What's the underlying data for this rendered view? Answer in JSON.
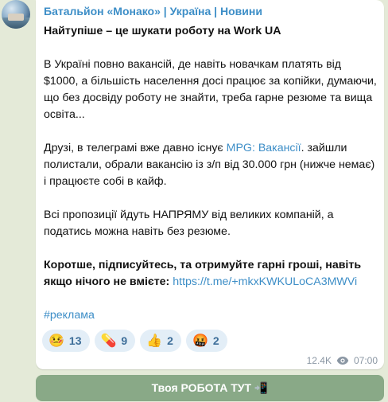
{
  "channel": {
    "name": "Батальйон «Монако» | Україна | Новини"
  },
  "post": {
    "title": "Найтупіше – це шукати роботу на Work UA",
    "para1": "В Україні повно вакансій, де навіть новачкам платять від $1000, а більшість населення досі працює за копійки, думаючи, що без досвіду роботу не знайти, треба гарне резюме та вища освіта...",
    "para2_before": "Друзі, в телеграмі вже давно існує ",
    "para2_link": "MPG: Вакансії",
    "para2_after": ". зайшли полистали, обрали вакансію із з/п від 30.000 грн (нижче немає) і працюєте собі в кайф.",
    "para3": "Всі пропозиції йдуть НАПРЯМУ від великих компаній, а податись можна навіть без резюме.",
    "para4_bold": "Коротше, підписуйтесь, та отримуйте гарні гроші, навіть якщо нічого не вмієте:",
    "para4_link": "https://t.me/+mkxKWKULoCA3MWVi",
    "hashtag": "#реклама"
  },
  "reactions": [
    {
      "emoji": "🤒",
      "icon": "sick-face",
      "count": "13"
    },
    {
      "emoji": "💊",
      "icon": "pill",
      "count": "9"
    },
    {
      "emoji": "👍",
      "icon": "thumbs-up",
      "count": "2"
    },
    {
      "emoji": "🤬",
      "icon": "cursing-face",
      "count": "2"
    }
  ],
  "meta": {
    "views": "12.4K",
    "time": "07:00"
  },
  "button": {
    "label": "Твоя РОБОТА ТУТ 📲"
  },
  "colors": {
    "accent": "#3d8ec7",
    "button": "#89a987",
    "background": "#e4ead8"
  }
}
